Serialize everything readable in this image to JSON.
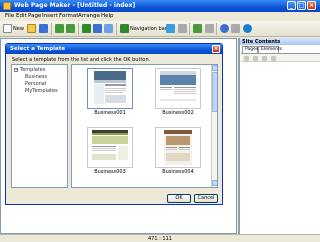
{
  "window": {
    "title": "Web Page Maker - [Untitled - index]"
  },
  "menu": {
    "items": [
      "File",
      "Edit",
      "Page",
      "Insert",
      "Format",
      "Arrange",
      "Help"
    ]
  },
  "toolbar": {
    "new_label": "New",
    "navigation_bar_label": "Navigation bar"
  },
  "panel": {
    "title": "Site Contents",
    "tabs": [
      "Pages",
      "Elements"
    ]
  },
  "status": {
    "coords": "471 : 111"
  },
  "dialog": {
    "title": "Select a Template",
    "instruction": "Select a template from the list and click the OK button.",
    "tree": {
      "root": "Templates",
      "children": [
        "Business",
        "Personal",
        "MyTemplates"
      ]
    },
    "templates": [
      {
        "name": "Business001"
      },
      {
        "name": "Business002"
      },
      {
        "name": "Business003"
      },
      {
        "name": "Business004"
      }
    ],
    "ok_label": "OK",
    "cancel_label": "Cancel"
  }
}
